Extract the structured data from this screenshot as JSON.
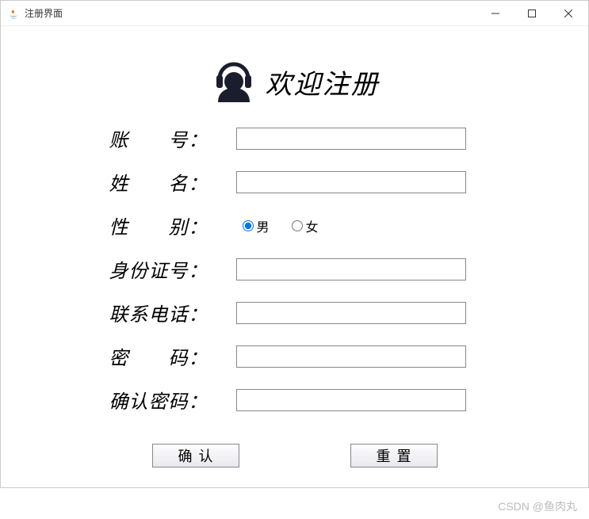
{
  "window": {
    "title": "注册界面"
  },
  "header": {
    "title": "欢迎注册"
  },
  "form": {
    "account_label": "账　　号：",
    "name_label": "姓　　名：",
    "gender_label": "性　　别：",
    "gender_male": "男",
    "gender_female": "女",
    "idcard_label": "身份证号：",
    "phone_label": "联系电话：",
    "password_label": "密　　码：",
    "confirm_label": "确认密码：",
    "account_value": "",
    "name_value": "",
    "idcard_value": "",
    "phone_value": "",
    "password_value": "",
    "confirm_value": ""
  },
  "buttons": {
    "confirm": "确认",
    "reset": "重置"
  },
  "watermark": "CSDN @鱼肉丸"
}
